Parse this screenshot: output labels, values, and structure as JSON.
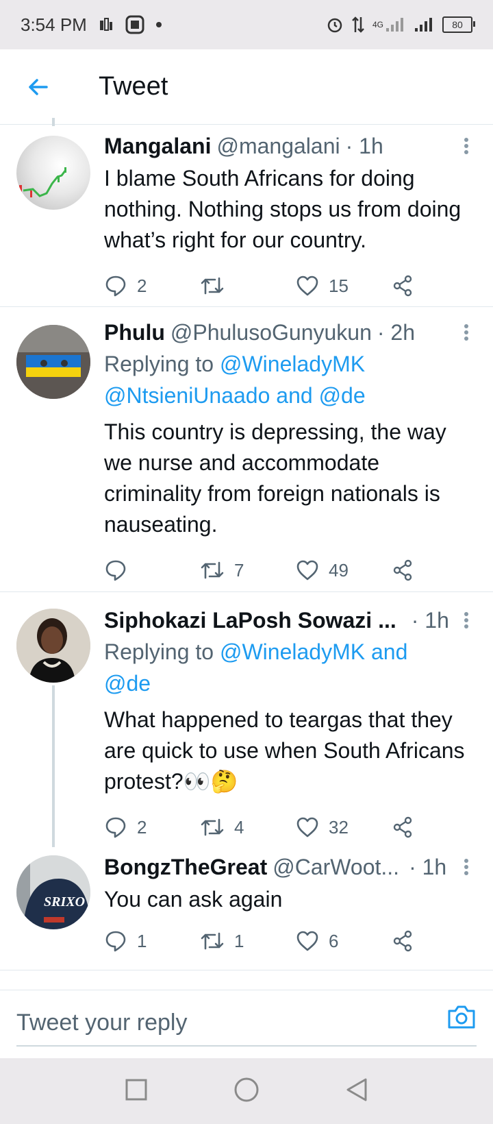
{
  "status_bar": {
    "time": "3:54 PM",
    "network": "4G",
    "battery": "80"
  },
  "header": {
    "title": "Tweet",
    "back_icon": "arrow-left-icon"
  },
  "tweets": [
    {
      "name": "Mangalani",
      "handle": "@mangalani",
      "time": "· 1h",
      "replying_prefix": "",
      "replying_mentions": "",
      "replying_mentions2": "",
      "text": "I blame South Africans for doing nothing. Nothing stops us from doing what’s right for our country.",
      "replies": "2",
      "retweets": "",
      "likes": "15"
    },
    {
      "name": "Phulu",
      "handle": "@PhulusoGunyukun",
      "time": "· 2h",
      "replying_prefix": "Replying to",
      "replying_mentions": "@WineladyMK",
      "replying_mentions2": "@NtsieniUnaado and @de",
      "text": "This country is depressing, the way we nurse and accommodate criminality from foreign nationals is nauseating.",
      "replies": "",
      "retweets": "7",
      "likes": "49"
    },
    {
      "name": "Siphokazi LaPosh Sowazi ...",
      "handle": "",
      "time": "· 1h",
      "replying_prefix": "Replying to",
      "replying_mentions": "@WineladyMK and",
      "replying_mentions2": "@de",
      "text": "What happened to teargas that they are quick to use when South Africans protest?👀🤔",
      "replies": "2",
      "retweets": "4",
      "likes": "32"
    },
    {
      "name": "BongzTheGreat",
      "handle": "@CarWoot...",
      "time": "· 1h",
      "replying_prefix": "",
      "replying_mentions": "",
      "replying_mentions2": "",
      "text": "You can ask again",
      "replies": "1",
      "retweets": "1",
      "likes": "6"
    }
  ],
  "reply_bar": {
    "placeholder": "Tweet your reply",
    "camera_icon": "camera-icon"
  },
  "colors": {
    "accent": "#1d9bf0",
    "text_primary": "#0f1419",
    "text_secondary": "#536471",
    "system_bar": "#ebe9ec"
  }
}
